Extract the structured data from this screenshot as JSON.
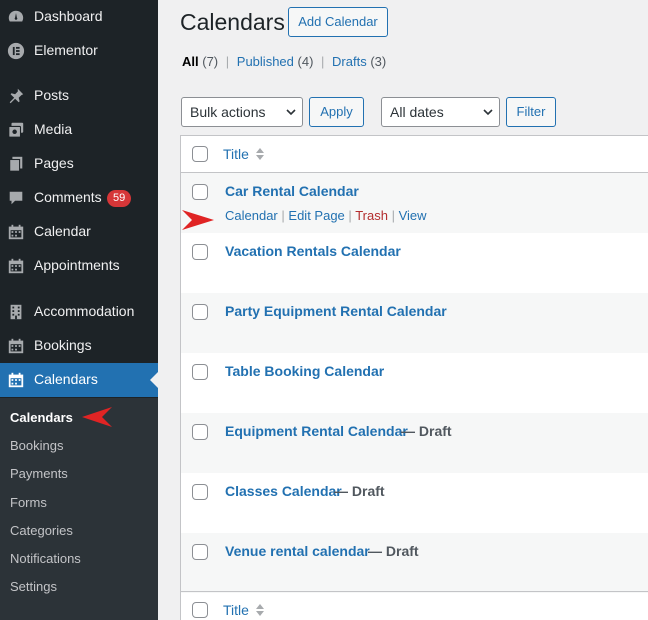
{
  "sidebar": {
    "items": [
      {
        "label": "Dashboard",
        "icon": "dashboard-icon"
      },
      {
        "label": "Elementor",
        "icon": "elementor-icon"
      },
      {
        "label": "Posts",
        "icon": "pin-icon"
      },
      {
        "label": "Media",
        "icon": "media-icon"
      },
      {
        "label": "Pages",
        "icon": "pages-icon"
      },
      {
        "label": "Comments",
        "icon": "comment-icon",
        "badge": "59"
      },
      {
        "label": "Calendar",
        "icon": "calendar-icon"
      },
      {
        "label": "Appointments",
        "icon": "calendar-icon"
      },
      {
        "label": "Accommodation",
        "icon": "building-icon"
      },
      {
        "label": "Bookings",
        "icon": "calendar-icon"
      },
      {
        "label": "Calendars",
        "icon": "calendar-icon",
        "current": true
      }
    ],
    "submenu": [
      "Calendars",
      "Bookings",
      "Payments",
      "Forms",
      "Categories",
      "Notifications",
      "Settings"
    ]
  },
  "header": {
    "title": "Calendars",
    "add_button": "Add Calendar"
  },
  "filters": {
    "all_label": "All",
    "all_count": "(7)",
    "published_label": "Published",
    "published_count": "(4)",
    "drafts_label": "Drafts",
    "drafts_count": "(3)",
    "sep": "|"
  },
  "toolbar": {
    "bulk_actions": "Bulk actions",
    "apply": "Apply",
    "dates": "All dates",
    "filter": "Filter"
  },
  "table": {
    "column_title": "Title",
    "rows": [
      {
        "title": "Car Rental Calendar",
        "state": ""
      },
      {
        "title": "Vacation Rentals Calendar",
        "state": ""
      },
      {
        "title": "Party Equipment Rental Calendar",
        "state": ""
      },
      {
        "title": "Table Booking Calendar",
        "state": ""
      },
      {
        "title": "Equipment Rental Calendar",
        "state": "— Draft"
      },
      {
        "title": "Classes Calendar",
        "state": "— Draft"
      },
      {
        "title": "Venue rental calendar",
        "state": "— Draft"
      }
    ],
    "row_actions": {
      "calendar": "Calendar",
      "edit_page": "Edit Page",
      "trash": "Trash",
      "view": "View",
      "sep": "|"
    }
  },
  "colors": {
    "sidebar_bg": "#1d2327",
    "accent": "#2271b1",
    "badge": "#d63638",
    "annotation_arrow": "#e02424"
  }
}
